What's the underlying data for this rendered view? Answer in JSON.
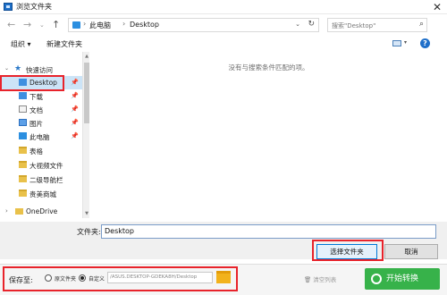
{
  "window": {
    "title": "浏览文件夹"
  },
  "address": {
    "crumbs": [
      "此电脑",
      "Desktop"
    ],
    "search_placeholder": "搜索\"Desktop\""
  },
  "toolbar": {
    "organize": "组织 ▾",
    "new_folder": "新建文件夹"
  },
  "nav": {
    "quick_access": "快速访问",
    "items": [
      {
        "label": "Desktop",
        "icon": "desktop-folder-icon",
        "pinned": true
      },
      {
        "label": "下载",
        "icon": "download-icon",
        "pinned": true
      },
      {
        "label": "文档",
        "icon": "document-icon",
        "pinned": true
      },
      {
        "label": "图片",
        "icon": "picture-icon",
        "pinned": true
      },
      {
        "label": "此电脑",
        "icon": "computer-icon",
        "pinned": true
      },
      {
        "label": "表格",
        "icon": "folder-icon",
        "pinned": false
      },
      {
        "label": "大视频文件",
        "icon": "folder-icon",
        "pinned": false
      },
      {
        "label": "二级导航栏",
        "icon": "folder-icon",
        "pinned": false
      },
      {
        "label": "贵美商城",
        "icon": "folder-icon",
        "pinned": false
      }
    ],
    "onedrive": "OneDrive"
  },
  "content": {
    "empty_message": "没有与搜索条件匹配的项。"
  },
  "folder_field": {
    "label": "文件夹:",
    "value": "Desktop"
  },
  "buttons": {
    "select_folder": "选择文件夹",
    "cancel": "取消"
  },
  "savebar": {
    "save_to": "保存至:",
    "option_original": "原文件夹",
    "option_custom": "自定义",
    "path": "/ASUS.DESKTOP-GDEKA8H/Desktop",
    "clear_list": "清空列表",
    "start": "开始转换"
  },
  "colors": {
    "highlight": "#e8232b",
    "start_button": "#37b24a",
    "selected": "#cce4f7"
  }
}
